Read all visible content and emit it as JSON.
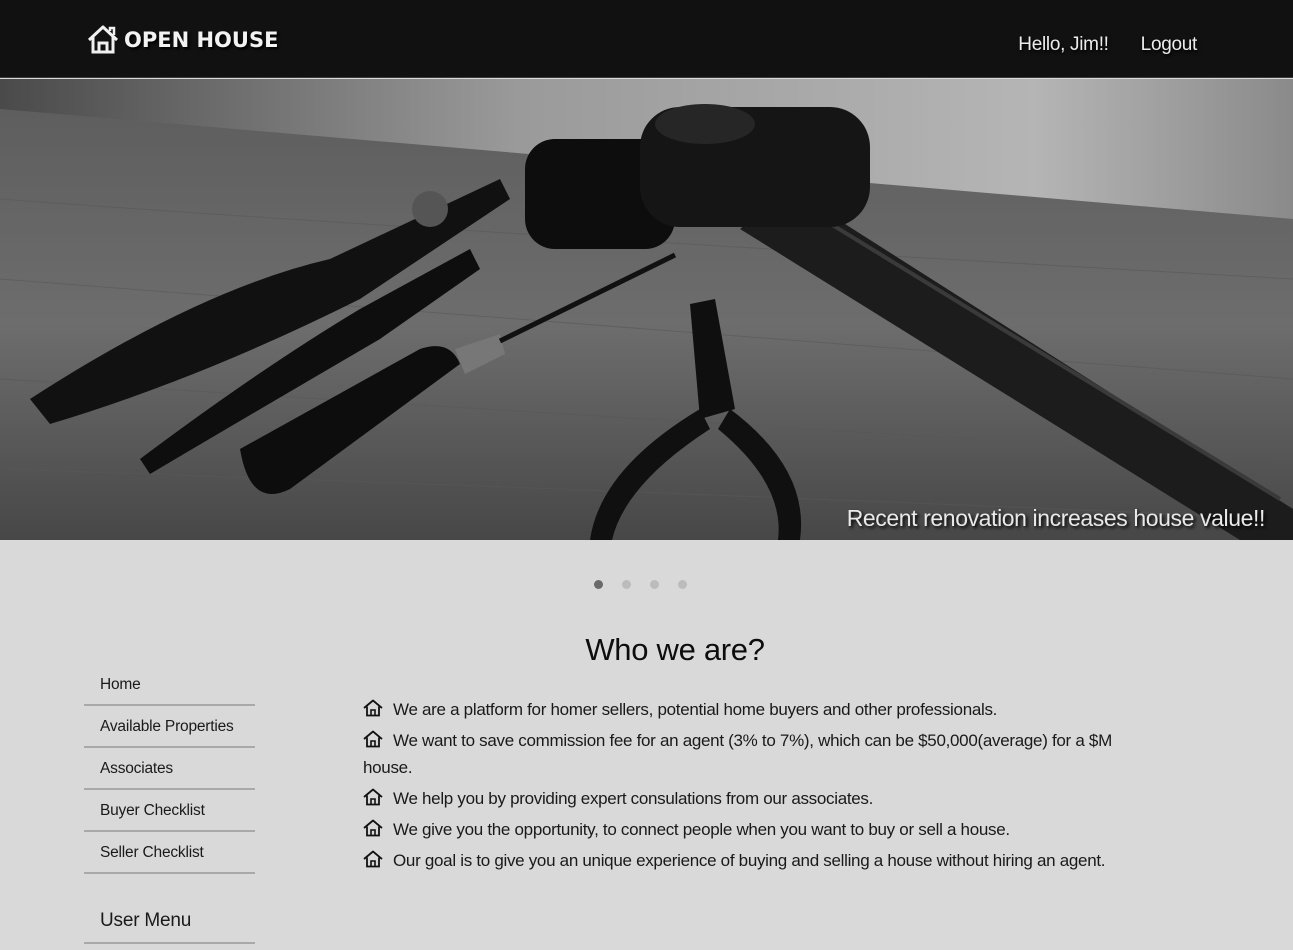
{
  "header": {
    "brand": "OPEN HOUSE",
    "brand_icon": "house-icon",
    "greeting": "Hello, Jim!!",
    "logout": "Logout"
  },
  "hero": {
    "caption": "Recent renovation increases house value!!",
    "slides_count": 4,
    "active_slide": 1
  },
  "sidebar": {
    "items": [
      {
        "label": "Home"
      },
      {
        "label": "Available Properties"
      },
      {
        "label": "Associates"
      },
      {
        "label": "Buyer Checklist"
      },
      {
        "label": "Seller Checklist"
      }
    ],
    "user_menu_title": "User Menu"
  },
  "main": {
    "title": "Who we are?",
    "points": [
      "We are a platform for homer sellers, potential home buyers and other professionals.",
      "We want to save commission fee for an agent (3% to 7%), which can be $50,000(average) for a $M house.",
      "We help you by providing expert consulations from our associates.",
      "We give you the opportunity, to connect people when you want to buy or sell a house.",
      "Our goal is to give you an unique experience of buying and selling a house without hiring an agent."
    ],
    "bullet_icon": "house-icon"
  },
  "colors": {
    "header_bg": "#111111",
    "page_bg": "#d9d9d9",
    "text": "#1a1a1a"
  }
}
